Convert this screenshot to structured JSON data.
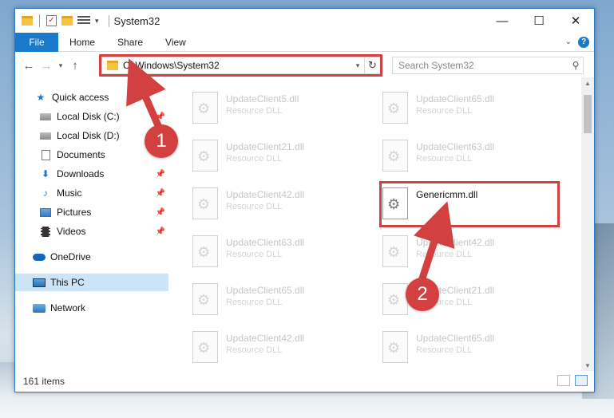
{
  "window": {
    "title": "System32",
    "controls": {
      "minimize": "—",
      "maximize": "☐",
      "close": "✕"
    }
  },
  "ribbon": {
    "tabs": [
      "File",
      "Home",
      "Share",
      "View"
    ],
    "help": "?"
  },
  "navbar": {
    "back": "←",
    "forward": "→",
    "recent": "▾",
    "up": "↑",
    "address": "C:\\Windows\\System32",
    "search_placeholder": "Search System32"
  },
  "sidebar": {
    "items": [
      {
        "label": "Quick access",
        "icon": "star-icon",
        "pinned": false
      },
      {
        "label": "Local Disk (C:)",
        "icon": "drive-icon",
        "pinned": true
      },
      {
        "label": "Local Disk (D:)",
        "icon": "drive-icon",
        "pinned": false
      },
      {
        "label": "Documents",
        "icon": "document-icon",
        "pinned": false
      },
      {
        "label": "Downloads",
        "icon": "download-icon",
        "pinned": true
      },
      {
        "label": "Music",
        "icon": "music-icon",
        "pinned": true
      },
      {
        "label": "Pictures",
        "icon": "pictures-icon",
        "pinned": true
      },
      {
        "label": "Videos",
        "icon": "videos-icon",
        "pinned": true
      },
      {
        "label": "OneDrive",
        "icon": "cloud-icon",
        "pinned": false
      },
      {
        "label": "This PC",
        "icon": "computer-icon",
        "pinned": false,
        "selected": true
      },
      {
        "label": "Network",
        "icon": "network-icon",
        "pinned": false
      }
    ]
  },
  "files": {
    "left_column": [
      {
        "name": "UpdateClient5.dll",
        "type": "Resource DLL"
      },
      {
        "name": "UpdateClient21.dll",
        "type": "Resource DLL"
      },
      {
        "name": "UpdateClient42.dll",
        "type": "Resource DLL"
      },
      {
        "name": "UpdateClient63.dll",
        "type": "Resource DLL"
      },
      {
        "name": "UpdateClient65.dll",
        "type": "Resource DLL"
      },
      {
        "name": "UpdateClient42.dll",
        "type": "Resource DLL"
      }
    ],
    "right_column": [
      {
        "name": "UpdateClient65.dll",
        "type": "Resource DLL"
      },
      {
        "name": "UpdateClient63.dll",
        "type": "Resource DLL"
      },
      {
        "name": "Genericmm.dll",
        "type": ""
      },
      {
        "name": "UpdateClient42.dll",
        "type": "Resource DLL"
      },
      {
        "name": "UpdateClient21.dll",
        "type": "Resource DLL"
      },
      {
        "name": "UpdateClient65.dll",
        "type": "Resource DLL"
      }
    ]
  },
  "status": {
    "item_count": "161 items"
  },
  "annotations": {
    "step1": "1",
    "step2": "2",
    "color": "#d2403f"
  }
}
